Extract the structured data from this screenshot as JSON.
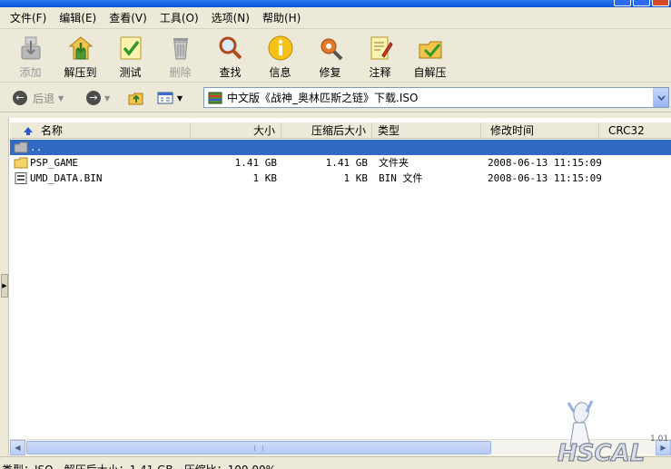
{
  "menu": [
    "文件(F)",
    "编辑(E)",
    "查看(V)",
    "工具(O)",
    "选项(N)",
    "帮助(H)"
  ],
  "toolbar": [
    {
      "label": "添加",
      "icon": "add-icon",
      "disabled": true
    },
    {
      "label": "解压到",
      "icon": "extract-to-icon",
      "disabled": false
    },
    {
      "label": "测试",
      "icon": "test-icon",
      "disabled": false
    },
    {
      "label": "删除",
      "icon": "delete-icon",
      "disabled": true
    },
    {
      "label": "查找",
      "icon": "find-icon",
      "disabled": false
    },
    {
      "label": "信息",
      "icon": "info-icon",
      "disabled": false
    },
    {
      "label": "修复",
      "icon": "repair-icon",
      "disabled": false
    },
    {
      "label": "注释",
      "icon": "comment-icon",
      "disabled": false
    },
    {
      "label": "自解压",
      "icon": "sfx-icon",
      "disabled": false
    }
  ],
  "nav": {
    "back_label": "后退"
  },
  "address": {
    "path": "中文版《战神_奥林匹斯之链》下载.ISO"
  },
  "columns": {
    "name": "名称",
    "size": "大小",
    "packed": "压缩后大小",
    "type": "类型",
    "modified": "修改时间",
    "crc": "CRC32"
  },
  "rows": [
    {
      "name": "..",
      "size": "",
      "packed": "",
      "type": "",
      "modified": "",
      "icon": "folder-up-icon",
      "selected": true
    },
    {
      "name": "PSP_GAME",
      "size": "1.41 GB",
      "packed": "1.41 GB",
      "type": "文件夹",
      "modified": "2008-06-13 11:15:09",
      "icon": "folder-icon",
      "selected": false
    },
    {
      "name": "UMD_DATA.BIN",
      "size": "1 KB",
      "packed": "1 KB",
      "type": "BIN 文件",
      "modified": "2008-06-13 11:15:09",
      "icon": "bin-file-icon",
      "selected": false
    }
  ],
  "status": "类型：ISO，解压后大小：1.41 GB，压缩比：100.00%",
  "colors": {
    "selection": "#316ac5",
    "chrome": "#ece9d8"
  }
}
